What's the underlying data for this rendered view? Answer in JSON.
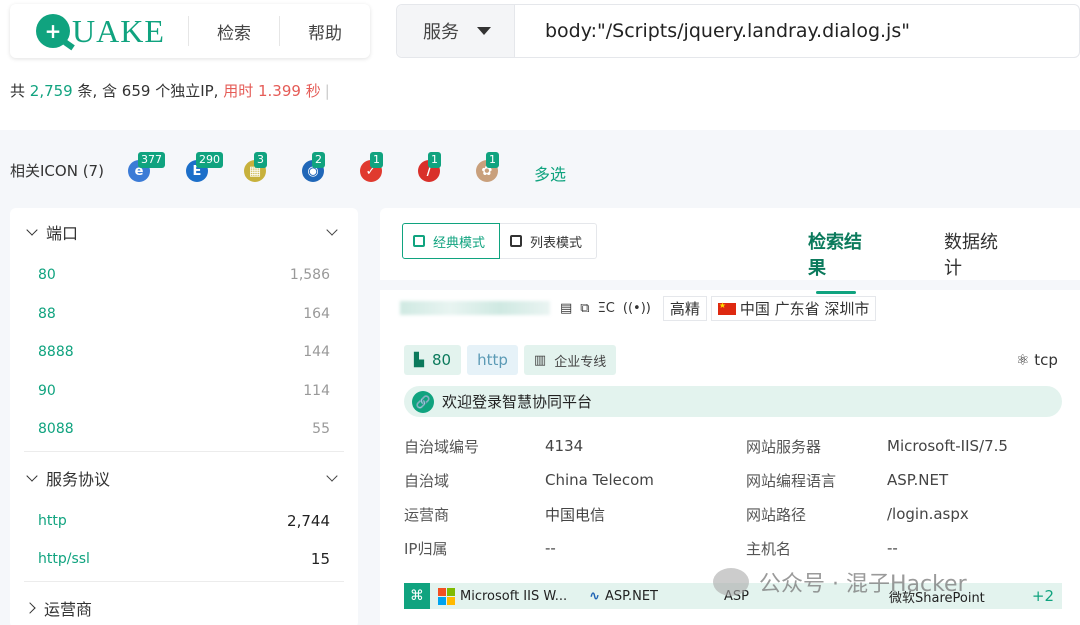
{
  "brand": {
    "logo_letter": "Q",
    "logo_text": "UAKE"
  },
  "nav": {
    "search": "检索",
    "help": "帮助"
  },
  "search": {
    "service_label": "服务",
    "query": "body:\"/Scripts/jquery.landray.dialog.js\""
  },
  "summary": {
    "prefix": "共 ",
    "total": "2,759",
    "mid": " 条, 含 659 个独立IP, ",
    "time": "用时 1.399 秒"
  },
  "icons": {
    "label": "相关ICON (7)",
    "items": [
      {
        "badge": "377",
        "name": "ie-like-icon",
        "color": "#3b7bd6",
        "glyph": "e"
      },
      {
        "badge": "290",
        "name": "e-square-icon",
        "color": "#1c6fc9",
        "glyph": "E"
      },
      {
        "badge": "3",
        "name": "yellow-app-icon",
        "color": "#c7b13c",
        "glyph": "▦"
      },
      {
        "badge": "2",
        "name": "blue-circle-icon",
        "color": "#2067b8",
        "glyph": "◉"
      },
      {
        "badge": "1",
        "name": "red-logo-icon",
        "color": "#e03a2f",
        "glyph": "✓"
      },
      {
        "badge": "1",
        "name": "red-quill-icon",
        "color": "#d9302a",
        "glyph": "/"
      },
      {
        "badge": "1",
        "name": "colorful-app-icon",
        "color": "#c9a07c",
        "glyph": "✿"
      }
    ],
    "multi_select": "多选"
  },
  "sidebar": {
    "port_title": "端口",
    "ports": [
      {
        "k": "80",
        "v": "1,586"
      },
      {
        "k": "88",
        "v": "164"
      },
      {
        "k": "8888",
        "v": "144"
      },
      {
        "k": "90",
        "v": "114"
      },
      {
        "k": "8088",
        "v": "55"
      }
    ],
    "protocol_title": "服务协议",
    "protocols": [
      {
        "k": "http",
        "v": "2,744"
      },
      {
        "k": "http/ssl",
        "v": "15"
      }
    ],
    "isp_title": "运营商"
  },
  "main": {
    "mode_classic": "经典模式",
    "mode_list": "列表模式",
    "tab_results": "检索结果",
    "tab_stats": "数据统计",
    "result": {
      "icon_ec": "ΞC",
      "precision": "高精",
      "location": "中国 广东省 深圳市",
      "port": "80",
      "protocol": "http",
      "line": "企业专线",
      "transport": "tcp",
      "title": "欢迎登录智慧协同平台",
      "kv": [
        {
          "l1": "自治域编号",
          "v1": "4134",
          "l2": "网站服务器",
          "v2": "Microsoft-IIS/7.5"
        },
        {
          "l1": "自治域",
          "v1": "China Telecom",
          "l2": "网站编程语言",
          "v2": "ASP.NET"
        },
        {
          "l1": "运营商",
          "v1": "中国电信",
          "l2": "网站路径",
          "v2": "/login.aspx"
        },
        {
          "l1": "IP归属",
          "v1": "--",
          "l2": "主机名",
          "v2": "--"
        }
      ],
      "tech": {
        "iis": "Microsoft IIS W...",
        "aspnet": "ASP.NET",
        "asp": "ASP",
        "sharepoint": "微软SharePoint",
        "more": "+2"
      }
    }
  },
  "watermark": "公众号 · 混子Hacker"
}
